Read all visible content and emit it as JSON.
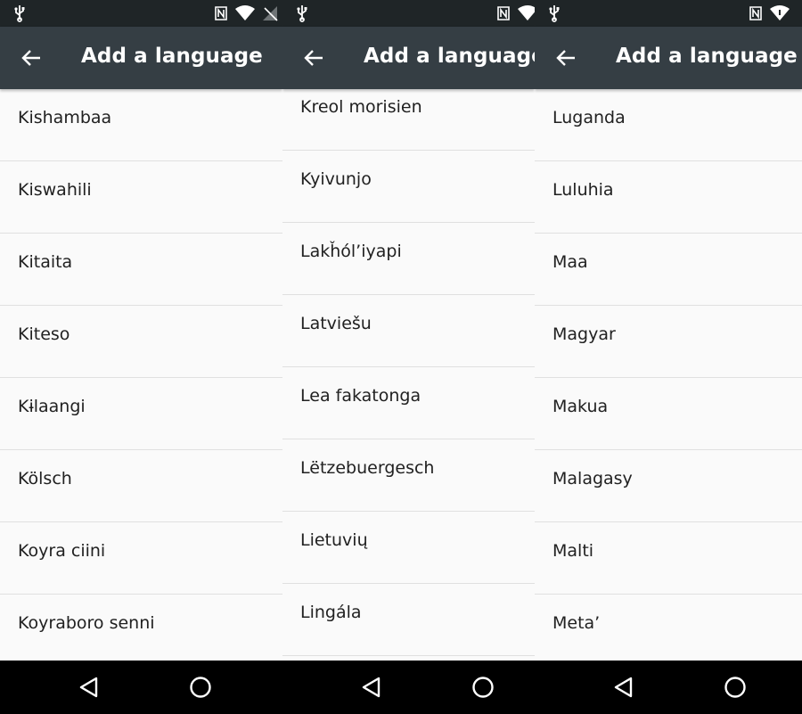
{
  "panels": [
    {
      "title": "Add a language",
      "items": [
        "Kishambaa",
        "Kiswahili",
        "Kitaita",
        "Kiteso",
        "Kɨlaangi",
        "Kölsch",
        "Koyra ciini",
        "Koyraboro senni"
      ]
    },
    {
      "title": "Add a language",
      "items": [
        "Kreol morisien",
        "Kyivunjo",
        "Lakȟól’iyapi",
        "Latviešu",
        "Lea fakatonga",
        "Lëtzebuergesch",
        "Lietuvių",
        "Lingála"
      ]
    },
    {
      "title": "Add a language",
      "items": [
        "Luganda",
        "Luluhia",
        "Maa",
        "Magyar",
        "Makua",
        "Malagasy",
        "Malti",
        "Meta’"
      ]
    }
  ],
  "icons": {
    "back": "arrow-left-icon",
    "usb": "usb-icon",
    "nfc": "nfc-icon",
    "wifi": "wifi-icon",
    "battery": "battery-icon",
    "nav_back": "triangle-back-icon",
    "nav_home": "circle-home-icon"
  },
  "colors": {
    "status_bar": "#1f2527",
    "toolbar": "#353e44",
    "list_bg": "#fafafa",
    "divider": "#e0e0e0",
    "text": "#212121"
  }
}
